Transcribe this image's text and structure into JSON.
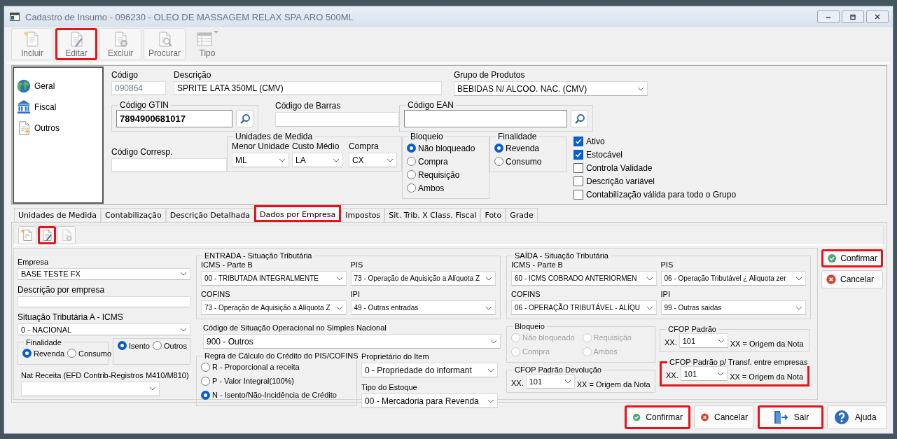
{
  "window": {
    "title": "Cadastro de Insumo - 096230 - OLEO DE MASSAGEM RELAX SPA ARO 500ML"
  },
  "toolbar": [
    {
      "label": "Incluir",
      "disabled": true,
      "highlighted": false
    },
    {
      "label": "Editar",
      "disabled": true,
      "highlighted": true
    },
    {
      "label": "Excluir",
      "disabled": true,
      "highlighted": false
    },
    {
      "label": "Procurar",
      "disabled": true,
      "highlighted": false
    },
    {
      "label": "Tipo",
      "disabled": true,
      "highlighted": false
    }
  ],
  "nav": [
    {
      "label": "Geral"
    },
    {
      "label": "Fiscal"
    },
    {
      "label": "Outros"
    }
  ],
  "product": {
    "codigo": {
      "label": "Código",
      "value": "090864",
      "disabled": true
    },
    "descricao": {
      "label": "Descrição",
      "value": "SPRITE LATA 350ML (CMV)"
    },
    "grupo": {
      "label": "Grupo de Produtos",
      "value": "BEBIDAS N/ ALCOO. NAC. (CMV)"
    },
    "gtin": {
      "label": "Código GTIN",
      "value": "7894900681017"
    },
    "barras": {
      "label": "Código de Barras"
    },
    "ean": {
      "label": "Código EAN"
    },
    "corresp": {
      "label": "Código Corresp."
    },
    "unidades": {
      "title": "Unidades de Medida",
      "fields": [
        {
          "label": "Menor Unidade",
          "value": "ML"
        },
        {
          "label": "Custo Médio",
          "value": "LA"
        },
        {
          "label": "Compra",
          "value": "CX"
        }
      ]
    },
    "bloqueio": {
      "title": "Bloqueio",
      "options": [
        {
          "label": "Não bloqueado",
          "selected": true
        },
        {
          "label": "Compra",
          "selected": false
        },
        {
          "label": "Requisição",
          "selected": false
        },
        {
          "label": "Ambos",
          "selected": false
        }
      ]
    },
    "finalidade": {
      "title": "Finalidade",
      "options": [
        {
          "label": "Revenda",
          "selected": true
        },
        {
          "label": "Consumo",
          "selected": false
        }
      ]
    },
    "flags": [
      {
        "label": "Ativo",
        "checked": true
      },
      {
        "label": "Estocável",
        "checked": true
      },
      {
        "label": "Controla Validade",
        "checked": false
      },
      {
        "label": "Descrição variável",
        "checked": false
      },
      {
        "label": "Contabilização válida para todo o Grupo",
        "checked": false
      }
    ]
  },
  "tabs": [
    {
      "label": "Unidades de Medida",
      "selected": false,
      "highlighted": false
    },
    {
      "label": "Contabilização",
      "selected": false,
      "highlighted": false
    },
    {
      "label": "Descrição Detalhada",
      "selected": false,
      "highlighted": false
    },
    {
      "label": "Dados por Empresa",
      "selected": true,
      "highlighted": true
    },
    {
      "label": "Impostos",
      "selected": false,
      "highlighted": false
    },
    {
      "label": "Sit. Trib. X Class. Fiscal",
      "selected": false,
      "highlighted": false
    },
    {
      "label": "Foto",
      "selected": false,
      "highlighted": false
    },
    {
      "label": "Grade",
      "selected": false,
      "highlighted": false
    }
  ],
  "tab_toolbar": [
    {
      "disabled": false,
      "highlighted": false
    },
    {
      "disabled": false,
      "highlighted": true
    },
    {
      "disabled": true,
      "highlighted": false
    }
  ],
  "empresa": {
    "empresa": {
      "label": "Empresa",
      "value": "BASE TESTE FX"
    },
    "descricao": {
      "label": "Descrição por empresa"
    },
    "situacao_a": {
      "label": "Situação Tributária A - ICMS",
      "value": "0 - NACIONAL"
    },
    "finalidade": {
      "title": "Finalidade",
      "options": [
        {
          "label": "Revenda",
          "selected": true
        },
        {
          "label": "Consumo",
          "selected": false
        }
      ]
    },
    "isencao": {
      "options": [
        {
          "label": "Isento",
          "selected": true
        },
        {
          "label": "Outros",
          "selected": false
        }
      ]
    },
    "nat_receita": {
      "label": "Nat Receita (EFD Contrib-Registros M410/M810)"
    },
    "entrada": {
      "title": "ENTRADA - Situação Tributária",
      "fields": [
        {
          "label": "ICMS - Parte B",
          "value": "00 - TRIBUTADA INTEGRALMENTE"
        },
        {
          "label": "PIS",
          "value": "73 - Operação de Aquisição a Alíquota Z"
        },
        {
          "label": "COFINS",
          "value": "73 - Operação de Aquisição a Alíquota Z"
        },
        {
          "label": "IPI",
          "value": "49 - Outras entradas"
        }
      ]
    },
    "csosn": {
      "label": "Código de Situação Operacional no Simples Nacional",
      "value": "900 - Outros"
    },
    "regra": {
      "title": "Regra de Cálculo do Crédito do PIS/COFINS",
      "options": [
        {
          "label": "R - Proporcional a receita",
          "selected": false
        },
        {
          "label": "P - Valor Integral(100%)",
          "selected": false
        },
        {
          "label": "N - Isento/Não-Incidência de Crédito",
          "selected": true
        }
      ]
    },
    "proprietario": {
      "label": "Proprietário do Item",
      "value": "0 - Propriedade do informant"
    },
    "tipo_estoque": {
      "label": "Tipo do Estoque",
      "value": "00 - Mercadoria para Revenda"
    },
    "saida": {
      "title": "SAÍDA - Situação Tributária",
      "fields": [
        {
          "label": "ICMS - Parte B",
          "value": "60 - ICMS COBRADO ANTERIORMEN"
        },
        {
          "label": "PIS",
          "value": "06 - Operação Tributável ¿ Aliquota zer"
        },
        {
          "label": "COFINS",
          "value": "06 - OPERAÇÃO TRIBUTÁVEL - ALÍQU"
        },
        {
          "label": "IPI",
          "value": "99 - Outras saidas"
        }
      ]
    },
    "bloqueio": {
      "title": "Bloqueio",
      "options": [
        {
          "label": "Não bloqueado",
          "selected": false,
          "disabled": true
        },
        {
          "label": "Requisição",
          "selected": false,
          "disabled": true
        },
        {
          "label": "Compra",
          "selected": false,
          "disabled": true
        },
        {
          "label": "Ambos",
          "selected": false,
          "disabled": true
        }
      ]
    },
    "cfop_devolucao": {
      "title": "CFOP Padrão Devolução",
      "prefix": "XX.",
      "value": "101",
      "note": "XX = Origem da Nota",
      "highlighted": false
    },
    "cfop": {
      "title": "CFOP Padrão",
      "prefix": "XX.",
      "value": "101",
      "note": "XX = Origem da Nota",
      "highlighted": false
    },
    "cfop_transf": {
      "title": "CFOP Padrão p/ Transf. entre empresas",
      "prefix": "XX.",
      "value": "101",
      "note": "XX = Origem da Nota",
      "highlighted": true
    }
  },
  "side_buttons": [
    {
      "label": "Confirmar",
      "highlighted": true
    },
    {
      "label": "Cancelar",
      "highlighted": false
    }
  ],
  "footer_buttons": [
    {
      "label": "Confirmar",
      "highlighted": true
    },
    {
      "label": "Cancelar",
      "highlighted": false
    },
    {
      "label": "Sair",
      "highlighted": true
    },
    {
      "label": "Ajuda",
      "highlighted": false
    }
  ]
}
